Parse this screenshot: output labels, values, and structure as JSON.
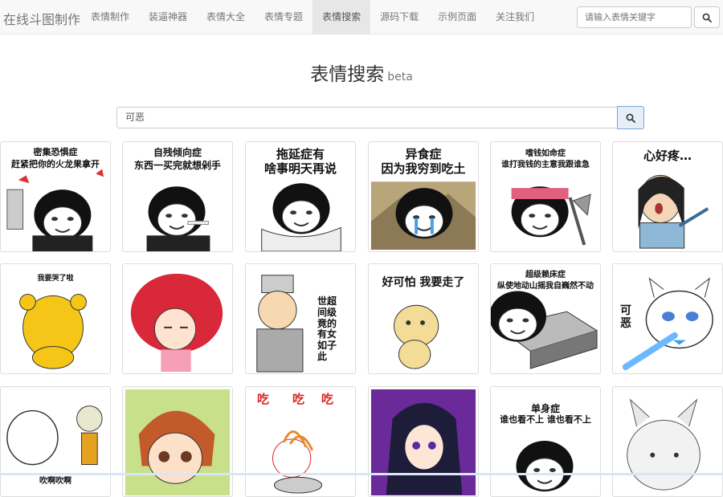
{
  "navbar": {
    "brand": "在线斗图制作",
    "items": [
      "表情制作",
      "装逼神器",
      "表情大全",
      "表情专题",
      "表情搜索",
      "源码下载",
      "示例页面",
      "关注我们"
    ],
    "active_index": 4,
    "search_placeholder": "请输入表情关键字"
  },
  "page": {
    "title": "表情搜索",
    "title_badge": "beta"
  },
  "search": {
    "value": "可恶"
  },
  "results": [
    {
      "caption": [
        "密集恐惧症",
        "赶紧把你的火龙果拿开"
      ],
      "icon": "panda-meme-cleaver"
    },
    {
      "caption": [
        "自残倾向症",
        "东西一买完就想剁手"
      ],
      "icon": "panda-meme-cigarette"
    },
    {
      "caption": [
        "拖延症有",
        "啥事明天再说"
      ],
      "icon": "panda-meme-lying"
    },
    {
      "caption": [
        "异食症",
        "因为我穷到吃土"
      ],
      "icon": "panda-meme-crying"
    },
    {
      "caption": [
        "嗜钱如命症",
        "谁打我钱的主意我跟谁急"
      ],
      "icon": "panda-meme-axe"
    },
    {
      "caption": [
        "心好疼…"
      ],
      "icon": "swordsman-cartoon"
    },
    {
      "caption": [
        "我要哭了啦"
      ],
      "icon": "yellow-bear-back"
    },
    {
      "caption": [],
      "icon": "afro-girl"
    },
    {
      "caption": [
        "超级的女子",
        "世间竟有如此"
      ],
      "icon": "official-cartoon"
    },
    {
      "caption": [
        "好可怕 我要走了"
      ],
      "icon": "scared-bear"
    },
    {
      "caption": [
        "超级赖床症",
        "纵使地动山摇我自巍然不动"
      ],
      "icon": "panda-meme-bed"
    },
    {
      "caption": [
        "可恶"
      ],
      "icon": "angry-cat-bat"
    },
    {
      "caption": [
        "吹啊吹啊"
      ],
      "icon": "cat-fan"
    },
    {
      "caption": [],
      "icon": "anime-boy"
    },
    {
      "caption": [
        "吃",
        "吃",
        "吃"
      ],
      "icon": "eating-noodles"
    },
    {
      "caption": [],
      "icon": "anime-girl"
    },
    {
      "caption": [
        "单身症",
        "谁也看不上 谁也看不上"
      ],
      "icon": "panda-meme-single"
    },
    {
      "caption": [],
      "icon": "grey-cat"
    }
  ]
}
